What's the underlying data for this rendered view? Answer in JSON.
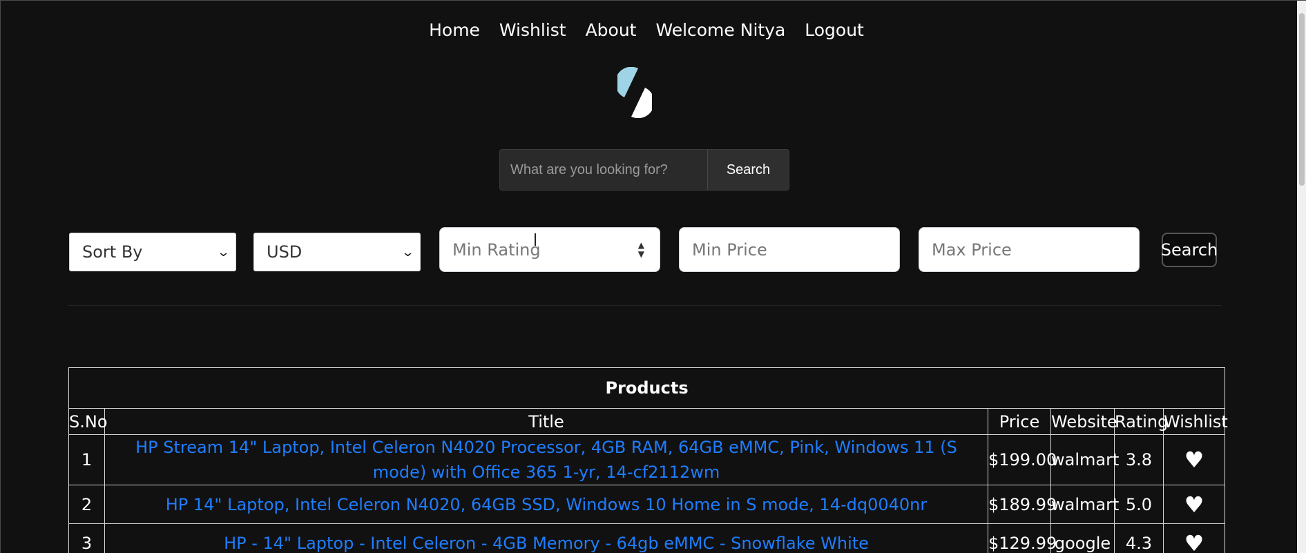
{
  "nav": {
    "home": "Home",
    "wishlist": "Wishlist",
    "about": "About",
    "welcome": "Welcome Nitya",
    "logout": "Logout"
  },
  "search": {
    "placeholder": "What are you looking for?",
    "button": "Search"
  },
  "filters": {
    "sort_by": "Sort By",
    "currency": "USD",
    "min_rating_placeholder": "Min Rating",
    "min_price_placeholder": "Min Price",
    "max_price_placeholder": "Max Price",
    "search_button": "Search"
  },
  "table": {
    "caption": "Products",
    "headers": {
      "sno": "S.No",
      "title": "Title",
      "price": "Price",
      "website": "Website",
      "rating": "Rating",
      "wishlist": "Wishlist"
    },
    "rows": [
      {
        "sno": "1",
        "title": "HP Stream 14\" Laptop, Intel Celeron N4020 Processor, 4GB RAM, 64GB eMMC, Pink, Windows 11 (S mode) with Office 365 1-yr, 14-cf2112wm",
        "price": "$199.00",
        "website": "walmart",
        "rating": "3.8",
        "wishlist": "♥"
      },
      {
        "sno": "2",
        "title": "HP 14\" Laptop, Intel Celeron N4020, 64GB SSD, Windows 10 Home in S mode, 14-dq0040nr",
        "price": "$189.99",
        "website": "walmart",
        "rating": "5.0",
        "wishlist": "♥"
      },
      {
        "sno": "3",
        "title": "HP - 14\" Laptop - Intel Celeron - 4GB Memory - 64gb eMMC - Snowflake White",
        "price": "$129.99",
        "website": "google",
        "rating": "4.3",
        "wishlist": "♥"
      }
    ]
  },
  "colors": {
    "background": "#111111",
    "link": "#1f7dff",
    "logo_accent": "#9fd3e6"
  }
}
